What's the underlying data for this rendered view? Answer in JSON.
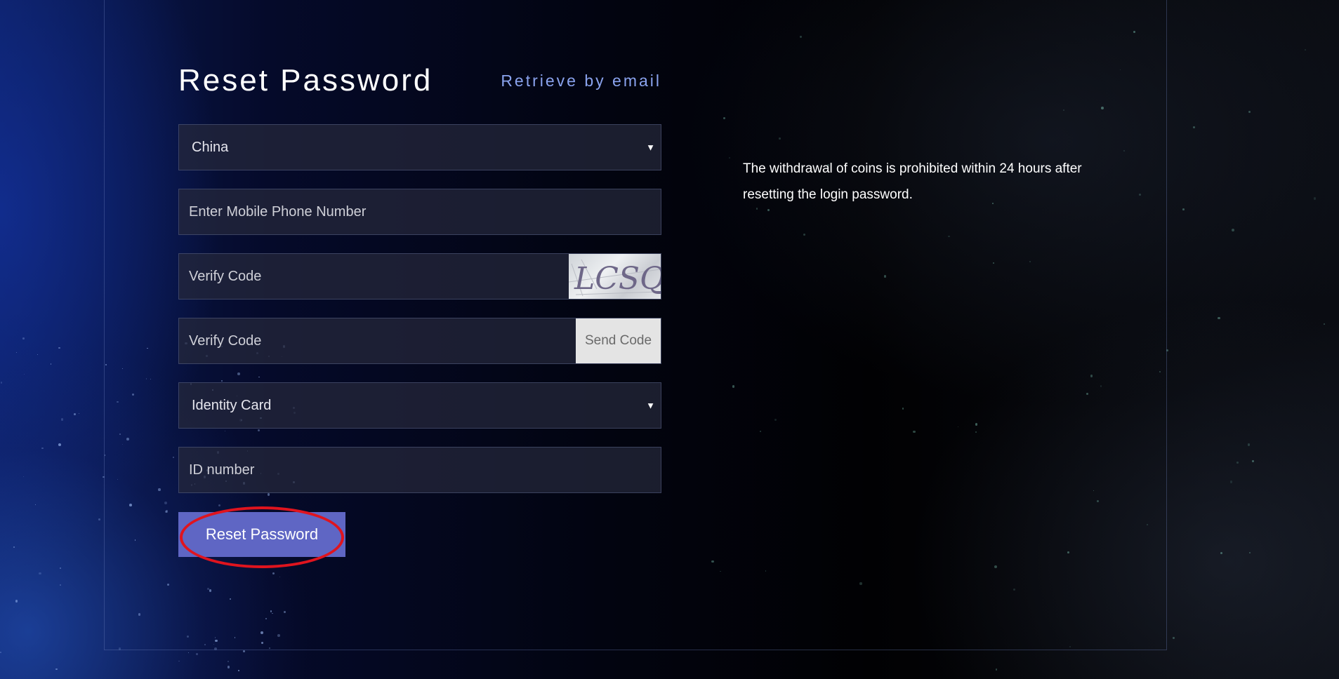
{
  "form": {
    "title": "Reset Password",
    "retrieve_link": "Retrieve by email",
    "country_select": {
      "value": "China"
    },
    "phone_input": {
      "placeholder": "Enter Mobile Phone Number"
    },
    "captcha_input": {
      "placeholder": "Verify Code"
    },
    "captcha_image": {
      "text": "LCSQ"
    },
    "sms_input": {
      "placeholder": "Verify Code"
    },
    "send_code_label": "Send Code",
    "id_type_select": {
      "value": "Identity Card"
    },
    "id_number_input": {
      "placeholder": "ID number"
    },
    "submit_label": "Reset Password"
  },
  "notice": {
    "text": "The withdrawal of coins is prohibited within 24 hours after resetting the login password."
  },
  "colors": {
    "accent_link": "#8aa3ee",
    "button": "#5f66c4",
    "annotation": "#e0141e"
  }
}
